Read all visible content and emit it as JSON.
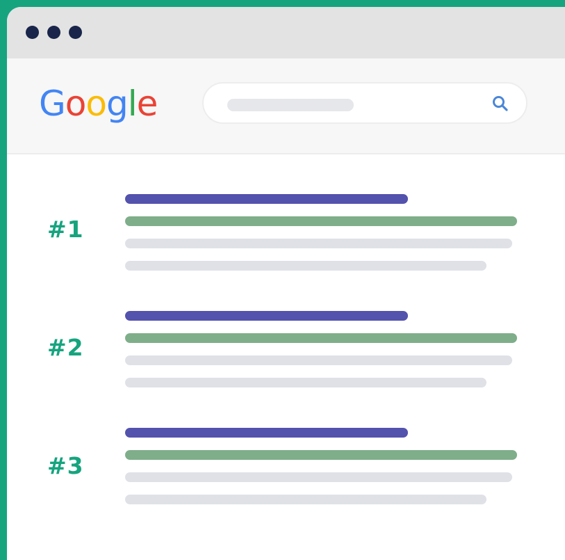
{
  "window": {
    "controls": [
      "window-dot",
      "window-dot",
      "window-dot"
    ]
  },
  "header": {
    "logo": {
      "letters": [
        {
          "char": "G",
          "color": "#4285F4"
        },
        {
          "char": "o",
          "color": "#EA4335"
        },
        {
          "char": "o",
          "color": "#FBBC05"
        },
        {
          "char": "g",
          "color": "#4285F4"
        },
        {
          "char": "l",
          "color": "#34A853"
        },
        {
          "char": "e",
          "color": "#EA4335"
        }
      ]
    },
    "search": {
      "value": "",
      "placeholder": "",
      "icon": "search-icon",
      "icon_color": "#4a86d8"
    }
  },
  "results": [
    {
      "rank": "#1"
    },
    {
      "rank": "#2"
    },
    {
      "rank": "#3"
    }
  ],
  "colors": {
    "frame": "#16a47e",
    "title_bar": "#5352ad",
    "url_bar": "#7fae8a",
    "snippet_bar": "#dfe1e6",
    "window_dots": "#19254a"
  }
}
